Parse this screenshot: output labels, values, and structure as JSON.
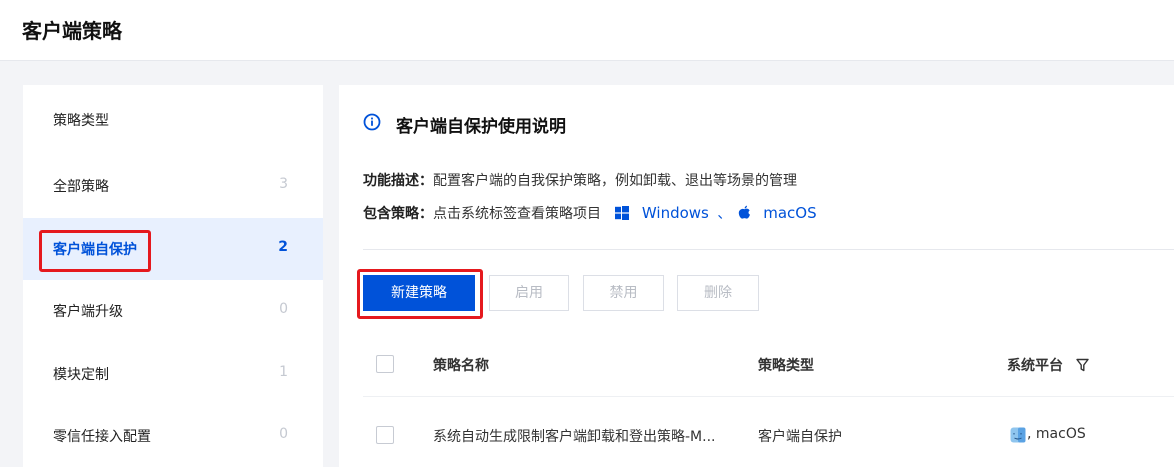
{
  "header": {
    "title": "客户端策略"
  },
  "sidebar": {
    "heading": "策略类型",
    "items": [
      {
        "label": "全部策略",
        "count": "3"
      },
      {
        "label": "客户端自保护",
        "count": "2"
      },
      {
        "label": "客户端升级",
        "count": "0"
      },
      {
        "label": "模块定制",
        "count": "1"
      },
      {
        "label": "零信任接入配置",
        "count": "0"
      }
    ],
    "active_index": 1
  },
  "info": {
    "title": "客户端自保护使用说明",
    "desc_key": "功能描述：",
    "desc_value": "配置客户端的自我保护策略，例如卸载、退出等场景的管理",
    "include_key": "包含策略：",
    "include_value": "点击系统标签查看策略项目",
    "link_windows": "Windows",
    "separator": "、",
    "link_macos": "macOS"
  },
  "toolbar": {
    "new_label": "新建策略",
    "enable_label": "启用",
    "disable_label": "禁用",
    "delete_label": "删除"
  },
  "table": {
    "headers": {
      "name": "策略名称",
      "type": "策略类型",
      "platform": "系统平台"
    },
    "rows": [
      {
        "name": "系统自动生成限制客户端卸载和登出策略-M...",
        "type": "客户端自保护",
        "platform": "macOS"
      }
    ]
  },
  "colors": {
    "primary": "#0052d9",
    "highlight": "#e5191e"
  }
}
